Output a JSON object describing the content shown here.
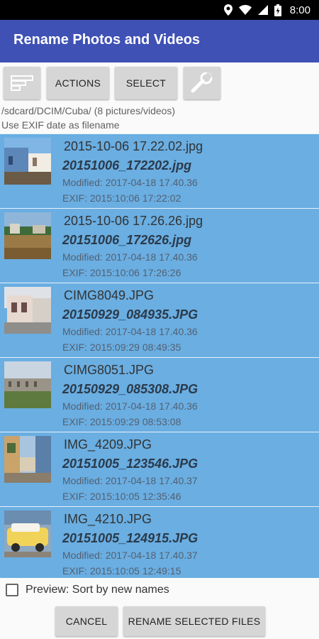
{
  "status_bar": {
    "time": "8:00",
    "icons": [
      "location-icon",
      "wifi-icon",
      "cell-signal-icon",
      "battery-icon"
    ]
  },
  "app_bar": {
    "title": "Rename Photos and Videos",
    "color": "#3f51b5"
  },
  "toolbar": {
    "sort_icon": "sort-icon",
    "actions_label": "ACTIONS",
    "select_label": "SELECT",
    "settings_icon": "wrench-icon"
  },
  "info": {
    "path": "/sdcard/DCIM/Cuba/ (8 pictures/videos)",
    "mode": "Use EXIF date as filename"
  },
  "files": [
    {
      "original": "2015-10-06 17.22.02.jpg",
      "new_name": "20151006_172202.jpg",
      "modified": "Modified: 2017-04-18 17.40.36",
      "exif": "EXIF: 2015:10:06 17:22:02"
    },
    {
      "original": "2015-10-06 17.26.26.jpg",
      "new_name": "20151006_172626.jpg",
      "modified": "Modified: 2017-04-18 17.40.36",
      "exif": "EXIF: 2015:10:06 17:26:26"
    },
    {
      "original": "CIMG8049.JPG",
      "new_name": "20150929_084935.JPG",
      "modified": "Modified: 2017-04-18 17.40.36",
      "exif": "EXIF: 2015:09:29 08:49:35"
    },
    {
      "original": "CIMG8051.JPG",
      "new_name": "20150929_085308.JPG",
      "modified": "Modified: 2017-04-18 17.40.36",
      "exif": "EXIF: 2015:09:29 08:53:08"
    },
    {
      "original": "IMG_4209.JPG",
      "new_name": "20151005_123546.JPG",
      "modified": "Modified: 2017-04-18 17.40.37",
      "exif": "EXIF: 2015:10:05 12:35:46"
    },
    {
      "original": "IMG_4210.JPG",
      "new_name": "20151005_124915.JPG",
      "modified": "Modified: 2017-04-18 17.40.37",
      "exif": "EXIF: 2015:10:05 12:49:15"
    }
  ],
  "selection_color": "#6aaee2",
  "preview": {
    "label": "Preview: Sort by new names",
    "checked": false
  },
  "buttons": {
    "cancel_label": "CANCEL",
    "rename_label": "RENAME SELECTED FILES"
  }
}
